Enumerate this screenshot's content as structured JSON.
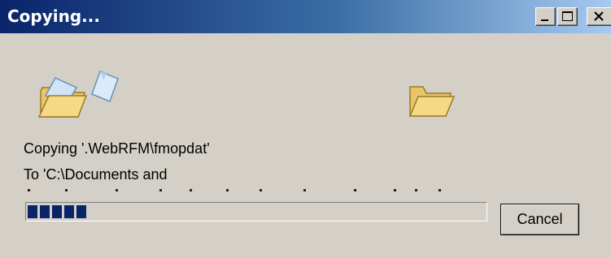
{
  "window": {
    "title": "Copying...",
    "controls": {
      "minimize": "minimize-icon",
      "maximize": "maximize-icon",
      "close": "close-icon"
    }
  },
  "animation": {
    "source_icon": "folder-open-icon",
    "flying_item_icon": "document-icon",
    "destination_icon": "folder-open-icon"
  },
  "status": {
    "line1": "Copying '.WebRFM\\fmopdat'",
    "line2": "To 'C:\\Documents and"
  },
  "progress": {
    "percent": 14
  },
  "buttons": {
    "cancel": "Cancel"
  },
  "colors": {
    "titlebar_start": "#0a246a",
    "titlebar_end": "#a6caf0",
    "progress_fill": "#0a246a",
    "face": "#d4d0c8"
  }
}
